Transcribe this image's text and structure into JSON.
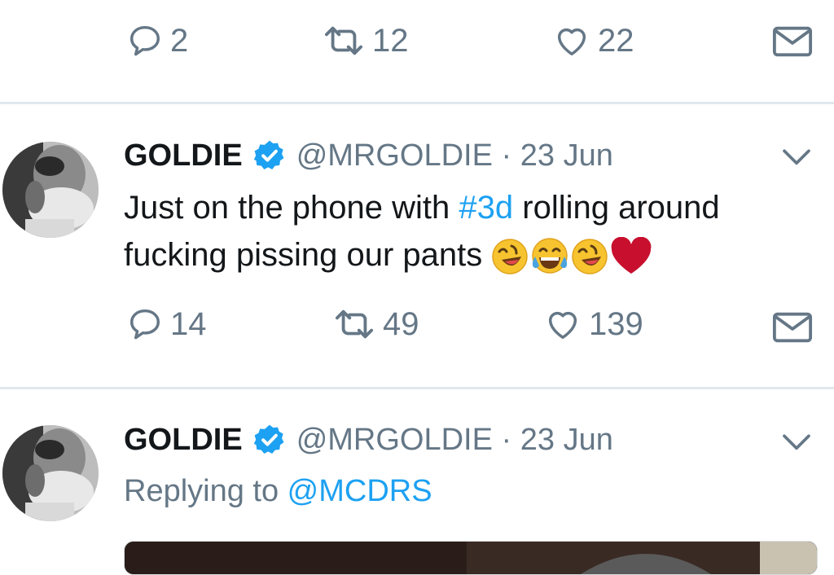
{
  "tweet0": {
    "actions": {
      "reply_count": "2",
      "retweet_count": "12",
      "like_count": "22"
    }
  },
  "tweet1": {
    "author_name": "GOLDIE",
    "handle": "@MRGOLDIE",
    "separator": " · ",
    "date": "23 Jun",
    "text_part1": "Just on the phone with ",
    "hashtag": "#3d",
    "text_part2": " rolling around fucking pissing our pants",
    "emojis": [
      "rolling-on-floor-laughing",
      "tears-of-joy",
      "rolling-on-floor-laughing",
      "red-heart"
    ],
    "actions": {
      "reply_count": "14",
      "retweet_count": "49",
      "like_count": "139"
    }
  },
  "tweet2": {
    "author_name": "GOLDIE",
    "handle": "@MRGOLDIE",
    "separator": " · ",
    "date": "23 Jun",
    "replying_prefix": "Replying to ",
    "replying_to": "@MCDRS"
  },
  "colors": {
    "text": "#14171a",
    "secondary": "#657786",
    "link": "#1da1f2",
    "verified": "#1da1f2",
    "divider": "#e1e8ed"
  }
}
